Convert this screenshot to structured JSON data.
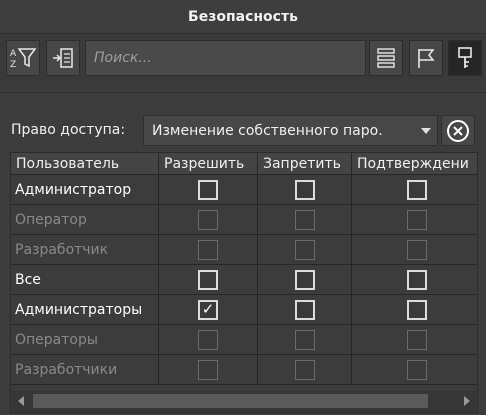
{
  "window": {
    "title": "Безопасность"
  },
  "toolbar": {
    "filter_icon": "filter-sort-icon",
    "import_icon": "import-icon",
    "search_placeholder": "Поиск...",
    "list_icon": "list-icon",
    "flag_icon": "flag-icon",
    "key_icon": "key-icon"
  },
  "access": {
    "label": "Право доступа:",
    "selected": "Изменение собственного паро.",
    "clear_icon": "clear-circle-x-icon"
  },
  "table": {
    "headers": [
      "Пользователь",
      "Разрешить",
      "Запретить",
      "Подтверждени"
    ],
    "rows": [
      {
        "name": "Администратор",
        "enabled": true,
        "allow": false,
        "deny": false,
        "confirm": false
      },
      {
        "name": "Оператор",
        "enabled": false,
        "allow": false,
        "deny": false,
        "confirm": false
      },
      {
        "name": "Разработчик",
        "enabled": false,
        "allow": false,
        "deny": false,
        "confirm": false
      },
      {
        "name": "Все",
        "enabled": true,
        "allow": false,
        "deny": false,
        "confirm": false
      },
      {
        "name": "Администраторы",
        "enabled": true,
        "allow": true,
        "deny": false,
        "confirm": false
      },
      {
        "name": "Операторы",
        "enabled": false,
        "allow": false,
        "deny": false,
        "confirm": false
      },
      {
        "name": "Разработчики",
        "enabled": false,
        "allow": false,
        "deny": false,
        "confirm": false
      }
    ],
    "check_glyph": "✓"
  }
}
